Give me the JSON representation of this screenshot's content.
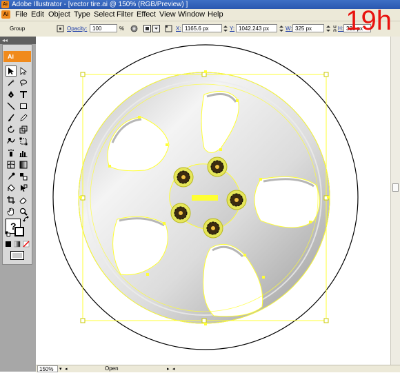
{
  "window": {
    "title": "Adobe Illustrator - [vector tire.ai @ 150% (RGB/Preview) ]"
  },
  "menu": {
    "app_badge": "Ai",
    "items": [
      "File",
      "Edit",
      "Object",
      "Type",
      "Select",
      "Filter",
      "Effect",
      "View",
      "Window",
      "Help"
    ]
  },
  "overlay": {
    "step_label": "19h"
  },
  "control_bar": {
    "selection_type": "Group",
    "opacity_label": "Opacity:",
    "opacity_value": "100",
    "opacity_unit": "%",
    "x_label": "X:",
    "x_value": "1165.6 px",
    "y_label": "Y:",
    "y_value": "1042.243 px",
    "w_label": "W:",
    "w_value": "325 px",
    "h_label": "H:",
    "h_value": "325 px"
  },
  "toolbox": {
    "collapse_glyph": "◂◂",
    "logo": "Ai"
  },
  "status_bar": {
    "zoom": "150%",
    "status": "Open"
  },
  "colors": {
    "selection": "#ffff33",
    "accent": "#f08a1c",
    "overlay_text": "#e8120e"
  }
}
